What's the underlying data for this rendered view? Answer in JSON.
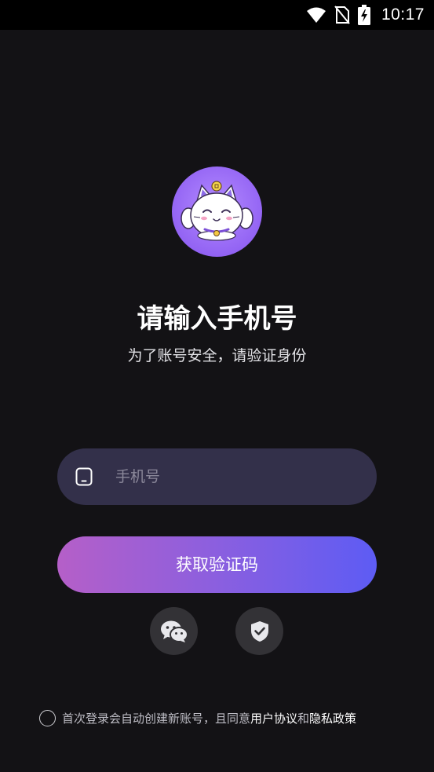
{
  "status_bar": {
    "time": "10:17",
    "icons": [
      "wifi-icon",
      "no-sim-icon",
      "battery-charging-icon"
    ]
  },
  "logo": {
    "icon": "lucky-cat-logo"
  },
  "header": {
    "title": "请输入手机号",
    "subtitle": "为了账号安全，请验证身份"
  },
  "phone_field": {
    "icon": "phone-icon",
    "placeholder": "手机号",
    "value": ""
  },
  "get_code_button": {
    "label": "获取验证码"
  },
  "alt_login": {
    "icons": [
      "wechat-icon",
      "shield-check-icon"
    ]
  },
  "agreement": {
    "prefix": "首次登录会自动创建新账号，且同意",
    "user_agreement": "用户协议",
    "and": "和",
    "privacy_policy": "隐私政策",
    "checked": false
  },
  "colors": {
    "background": "#131215",
    "input_bg": "#33304a",
    "gradient_start": "#b55fc8",
    "gradient_end": "#5d5cf4",
    "logo_purple": "#9a6cf6"
  }
}
